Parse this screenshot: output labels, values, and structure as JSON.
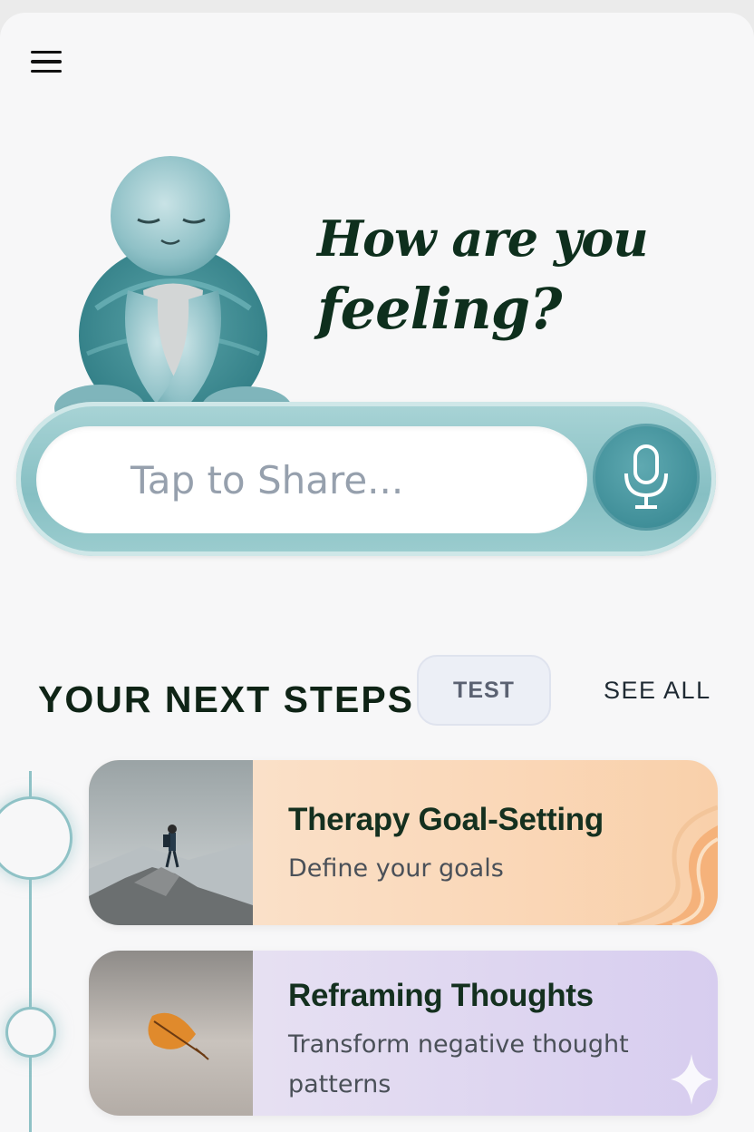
{
  "header": {
    "menu_icon": "hamburger-menu-icon"
  },
  "hero": {
    "heading_line1": "How are you",
    "heading_line2": "feeling?",
    "mascot": "meditating-turtle-illustration"
  },
  "share": {
    "placeholder": "Tap to Share...",
    "mic_icon": "microphone-icon"
  },
  "next_steps": {
    "title": "YOUR NEXT STEPS",
    "test_label": "TEST",
    "see_all_label": "SEE ALL",
    "items": [
      {
        "title": "Therapy Goal-Setting",
        "subtitle": "Define your goals",
        "image": "hiker-on-mountain-photo",
        "color": "#f9d0aa"
      },
      {
        "title": "Reframing Thoughts",
        "subtitle": "Transform negative thought patterns",
        "image": "falling-leaf-photo",
        "color": "#d7cdef"
      }
    ]
  },
  "colors": {
    "accent_teal": "#3f8e98",
    "heading_green": "#0e2f1d",
    "background": "#f7f7f8"
  }
}
